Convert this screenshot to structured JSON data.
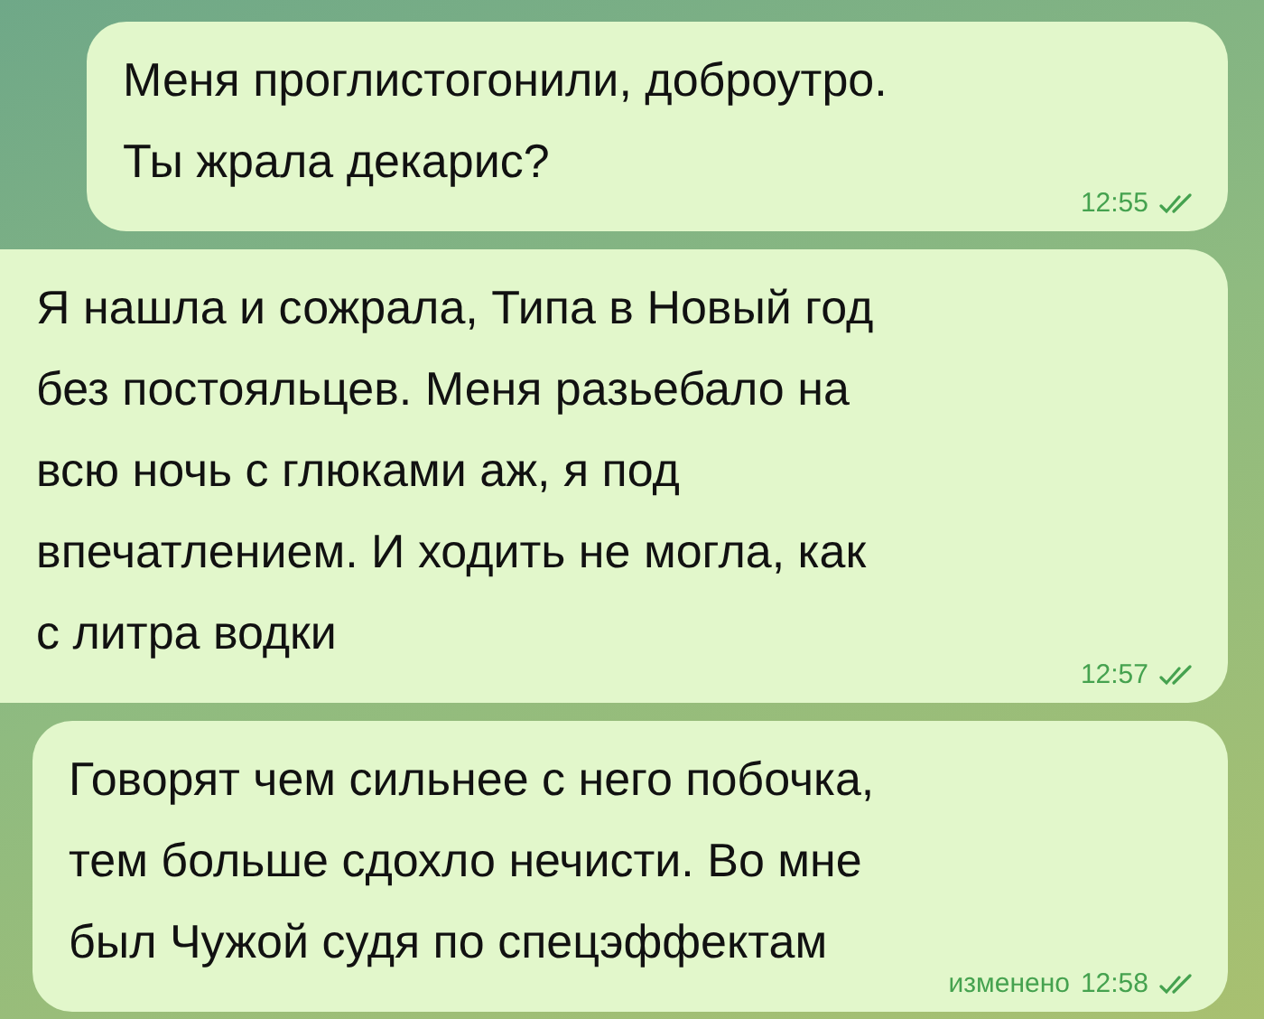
{
  "messages": [
    {
      "lines": [
        "Меня проглистогонили, доброутро.",
        "Ты жрала декарис?"
      ],
      "time": "12:55",
      "read": true
    },
    {
      "lines": [
        "Я нашла и сожрала, Типа в Новый год",
        "без постояльцев. Меня разьебало на",
        "всю ночь с глюками аж, я под",
        "впечатлением. И ходить не могла, как",
        "с литра водки"
      ],
      "time": "12:57",
      "read": true
    },
    {
      "lines": [
        "Говорят чем сильнее с него побочка,",
        "тем больше сдохло нечисти. Во мне",
        "был Чужой судя по спецэффектам"
      ],
      "edited_label": "изменено",
      "time": "12:58",
      "read": true
    }
  ]
}
